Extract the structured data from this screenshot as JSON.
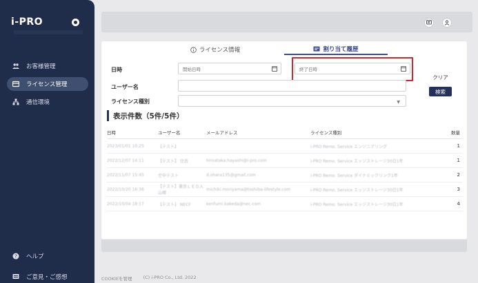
{
  "sidebar": {
    "logo": "i-PRO",
    "nav": [
      {
        "label": "お客様管理",
        "icon": "users-icon"
      },
      {
        "label": "ライセンス管理",
        "icon": "license-icon"
      },
      {
        "label": "通信環境",
        "icon": "network-icon"
      }
    ],
    "bottom": [
      {
        "label": "ヘルプ",
        "icon": "help-icon"
      },
      {
        "label": "ご意見・ご感想",
        "icon": "feedback-icon"
      }
    ]
  },
  "tabs": {
    "info": "ライセンス情報",
    "history": "割り当て履歴"
  },
  "form": {
    "datetime_label": "日時",
    "username_label": "ユーザー名",
    "license_type_label": "ライセンス種別",
    "start_placeholder": "開始日時",
    "end_placeholder": "終了日時",
    "clear_button": "クリア",
    "search_button": "検索"
  },
  "results": {
    "title": "表示件数（5件/5件）"
  },
  "table": {
    "headers": [
      "日時",
      "ユーザー名",
      "メールアドレス",
      "ライセンス種別",
      "数量"
    ],
    "rows": [
      {
        "date": "2023/01/01 10:25",
        "user": "【テスト】",
        "email": "",
        "license": "i-PRO Remo. Service エンジニアリング",
        "qty": "1"
      },
      {
        "date": "2022/12/07 14:11",
        "user": "【テスト】 住吉",
        "email": "hiroataka.hayashi@i-pro.com",
        "license": "i-PRO Remo. Service エッジストレージ30日1年",
        "qty": "1"
      },
      {
        "date": "2022/11/07 15:45",
        "user": "空中テスト",
        "email": "d.ohara135@gmail.com",
        "license": "i-PRO Remo. Service ダイナミックリンク1年",
        "qty": "2"
      },
      {
        "date": "2022/10/20 16:36",
        "user": "【テスト】東京ＬＥＤ入山様",
        "email": "michiki.moriyama@toshiba-lifestyle.com",
        "license": "i-PRO Remo. Service エッジストレージ30日1年",
        "qty": "3"
      },
      {
        "date": "2022/10/04 18:17",
        "user": "【テスト】 NECF",
        "email": "kenfumi.kakeda@nec.com",
        "license": "i-PRO Remo. Service エッジストレージ30日1年",
        "qty": "4"
      }
    ]
  },
  "footer": {
    "cookie": "COOKIEを管理",
    "copyright": "(C) i-PRO Co., Ltd. 2022"
  }
}
